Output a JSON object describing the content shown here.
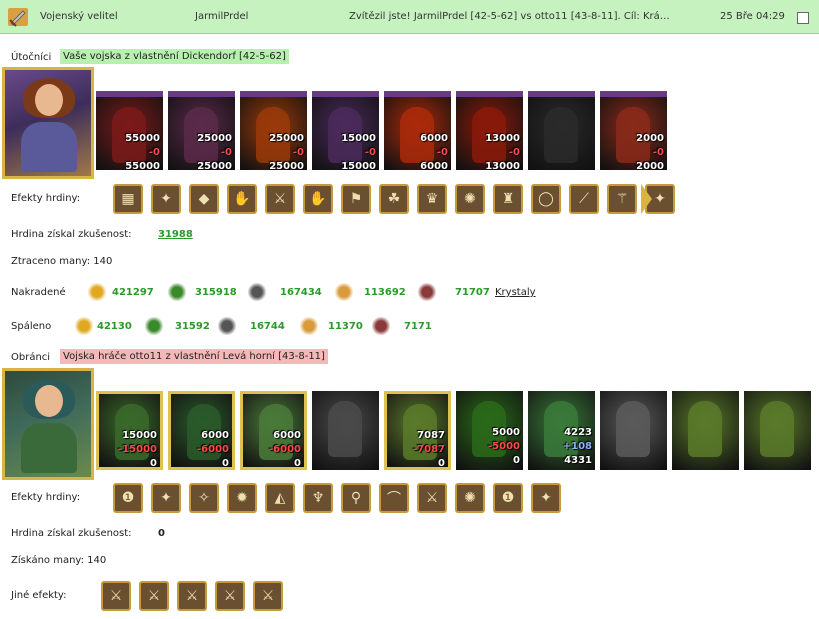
{
  "header": {
    "title": "Vojenský velitel",
    "player": "JarmilPrdel",
    "result": "Zvítězil jste! JarmilPrdel [42-5-62] vs otto11 [43-8-11]. Cíl: Krá…",
    "date": "25 Bře 04:29"
  },
  "attackers": {
    "label": "Útočníci",
    "tag": "Vaše vojska z vlastnění Dickendorf [42-5-62]",
    "units": [
      {
        "a": "55000",
        "b": "-0",
        "c": "55000",
        "color": "#7a1a1a"
      },
      {
        "a": "25000",
        "b": "-0",
        "c": "25000",
        "color": "#5a2a4a"
      },
      {
        "a": "25000",
        "b": "-0",
        "c": "25000",
        "color": "#9a3a0a"
      },
      {
        "a": "15000",
        "b": "-0",
        "c": "15000",
        "color": "#4a2a5a"
      },
      {
        "a": "6000",
        "b": "-0",
        "c": "6000",
        "color": "#aa2a0a"
      },
      {
        "a": "13000",
        "b": "-0",
        "c": "13000",
        "color": "#8a1a0a"
      },
      {
        "a": "",
        "b": "",
        "c": "",
        "color": "#2a2a2a"
      },
      {
        "a": "2000",
        "b": "-0",
        "c": "2000",
        "color": "#8a2a1a"
      }
    ],
    "effects_label": "Efekty hrdiny:",
    "xp_label": "Hrdina získal zkušenost:",
    "xp_value": "31988",
    "mana_label": "Ztraceno many: 140",
    "stolen_label": "Nakradené",
    "stolen": [
      "421297",
      "315918",
      "167434",
      "113692",
      "71707"
    ],
    "crystals_link": "Krystaly",
    "burned_label": "Spáleno",
    "burned": [
      "42130",
      "31592",
      "16744",
      "11370",
      "7171"
    ]
  },
  "defenders": {
    "label": "Obránci",
    "tag": "Vojska hráče otto11 z vlastnění Levá horní [43-8-11]",
    "units": [
      {
        "a": "15000",
        "b": "-15000",
        "c": "0",
        "color": "#3a6a2a"
      },
      {
        "a": "6000",
        "b": "-6000",
        "c": "0",
        "color": "#2a5a2a"
      },
      {
        "a": "6000",
        "b": "-6000",
        "c": "0",
        "color": "#4a7a3a"
      },
      {
        "a": "",
        "b": "",
        "c": "",
        "color": "#4a4a4a"
      },
      {
        "a": "7087",
        "b": "-7087",
        "c": "0",
        "color": "#5a7a2a"
      },
      {
        "a": "5000",
        "b": "-5000",
        "c": "0",
        "color": "#2a6a1a"
      },
      {
        "a": "4223",
        "b": "+108",
        "c": "4331",
        "color": "#3a7a3a"
      },
      {
        "a": "",
        "b": "",
        "c": "",
        "color": "#5a5a5a"
      },
      {
        "a": "",
        "b": "",
        "c": "",
        "color": "#5a7a2a"
      },
      {
        "a": "",
        "b": "",
        "c": "",
        "color": "#5a7a2a"
      }
    ],
    "effects_label": "Efekty hrdiny:",
    "xp_label": "Hrdina získal zkušenost:",
    "xp_value": "0",
    "mana_label": "Získáno many: 140",
    "other_label": "Jiné efekty:"
  }
}
